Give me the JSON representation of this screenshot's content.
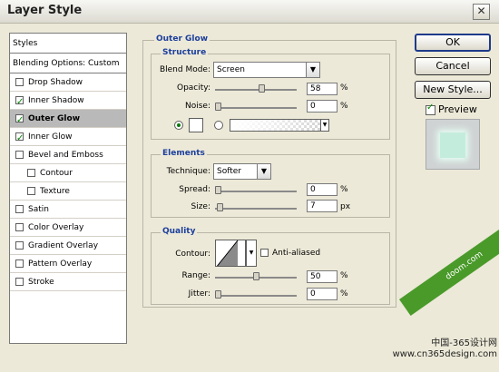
{
  "window": {
    "title": "Layer Style",
    "close_glyph": "✕"
  },
  "sidebar": {
    "header": "Styles",
    "blending": "Blending Options: Custom",
    "items": [
      {
        "label": "Drop Shadow",
        "checked": false,
        "selected": false,
        "indent": false
      },
      {
        "label": "Inner Shadow",
        "checked": true,
        "selected": false,
        "indent": false
      },
      {
        "label": "Outer Glow",
        "checked": true,
        "selected": true,
        "indent": false
      },
      {
        "label": "Inner Glow",
        "checked": true,
        "selected": false,
        "indent": false
      },
      {
        "label": "Bevel and Emboss",
        "checked": false,
        "selected": false,
        "indent": false
      },
      {
        "label": "Contour",
        "checked": false,
        "selected": false,
        "indent": true
      },
      {
        "label": "Texture",
        "checked": false,
        "selected": false,
        "indent": true
      },
      {
        "label": "Satin",
        "checked": false,
        "selected": false,
        "indent": false
      },
      {
        "label": "Color Overlay",
        "checked": false,
        "selected": false,
        "indent": false
      },
      {
        "label": "Gradient Overlay",
        "checked": false,
        "selected": false,
        "indent": false
      },
      {
        "label": "Pattern Overlay",
        "checked": false,
        "selected": false,
        "indent": false
      },
      {
        "label": "Stroke",
        "checked": false,
        "selected": false,
        "indent": false
      }
    ]
  },
  "outer_glow": {
    "title": "Outer Glow",
    "structure": {
      "title": "Structure",
      "blend_mode_label": "Blend Mode:",
      "blend_mode_value": "Screen",
      "opacity_label": "Opacity:",
      "opacity_value": "58",
      "opacity_level": 0.58,
      "noise_label": "Noise:",
      "noise_value": "0",
      "noise_level": 0.0,
      "percent": "%"
    },
    "elements": {
      "title": "Elements",
      "technique_label": "Technique:",
      "technique_value": "Softer",
      "spread_label": "Spread:",
      "spread_value": "0",
      "spread_level": 0.0,
      "size_label": "Size:",
      "size_value": "7",
      "size_level": 0.03,
      "percent": "%",
      "px": "px"
    },
    "quality": {
      "title": "Quality",
      "contour_label": "Contour:",
      "anti_aliased_label": "Anti-aliased",
      "range_label": "Range:",
      "range_value": "50",
      "range_level": 0.5,
      "jitter_label": "Jitter:",
      "jitter_value": "0",
      "jitter_level": 0.0,
      "percent": "%"
    }
  },
  "buttons": {
    "ok": "OK",
    "cancel": "Cancel",
    "new_style": "New Style...",
    "preview_label": "Preview",
    "preview_checked": true
  },
  "watermark": {
    "banner": "doom.com",
    "line1": "中国-365设计网",
    "line2": "www.cn365design.com"
  }
}
